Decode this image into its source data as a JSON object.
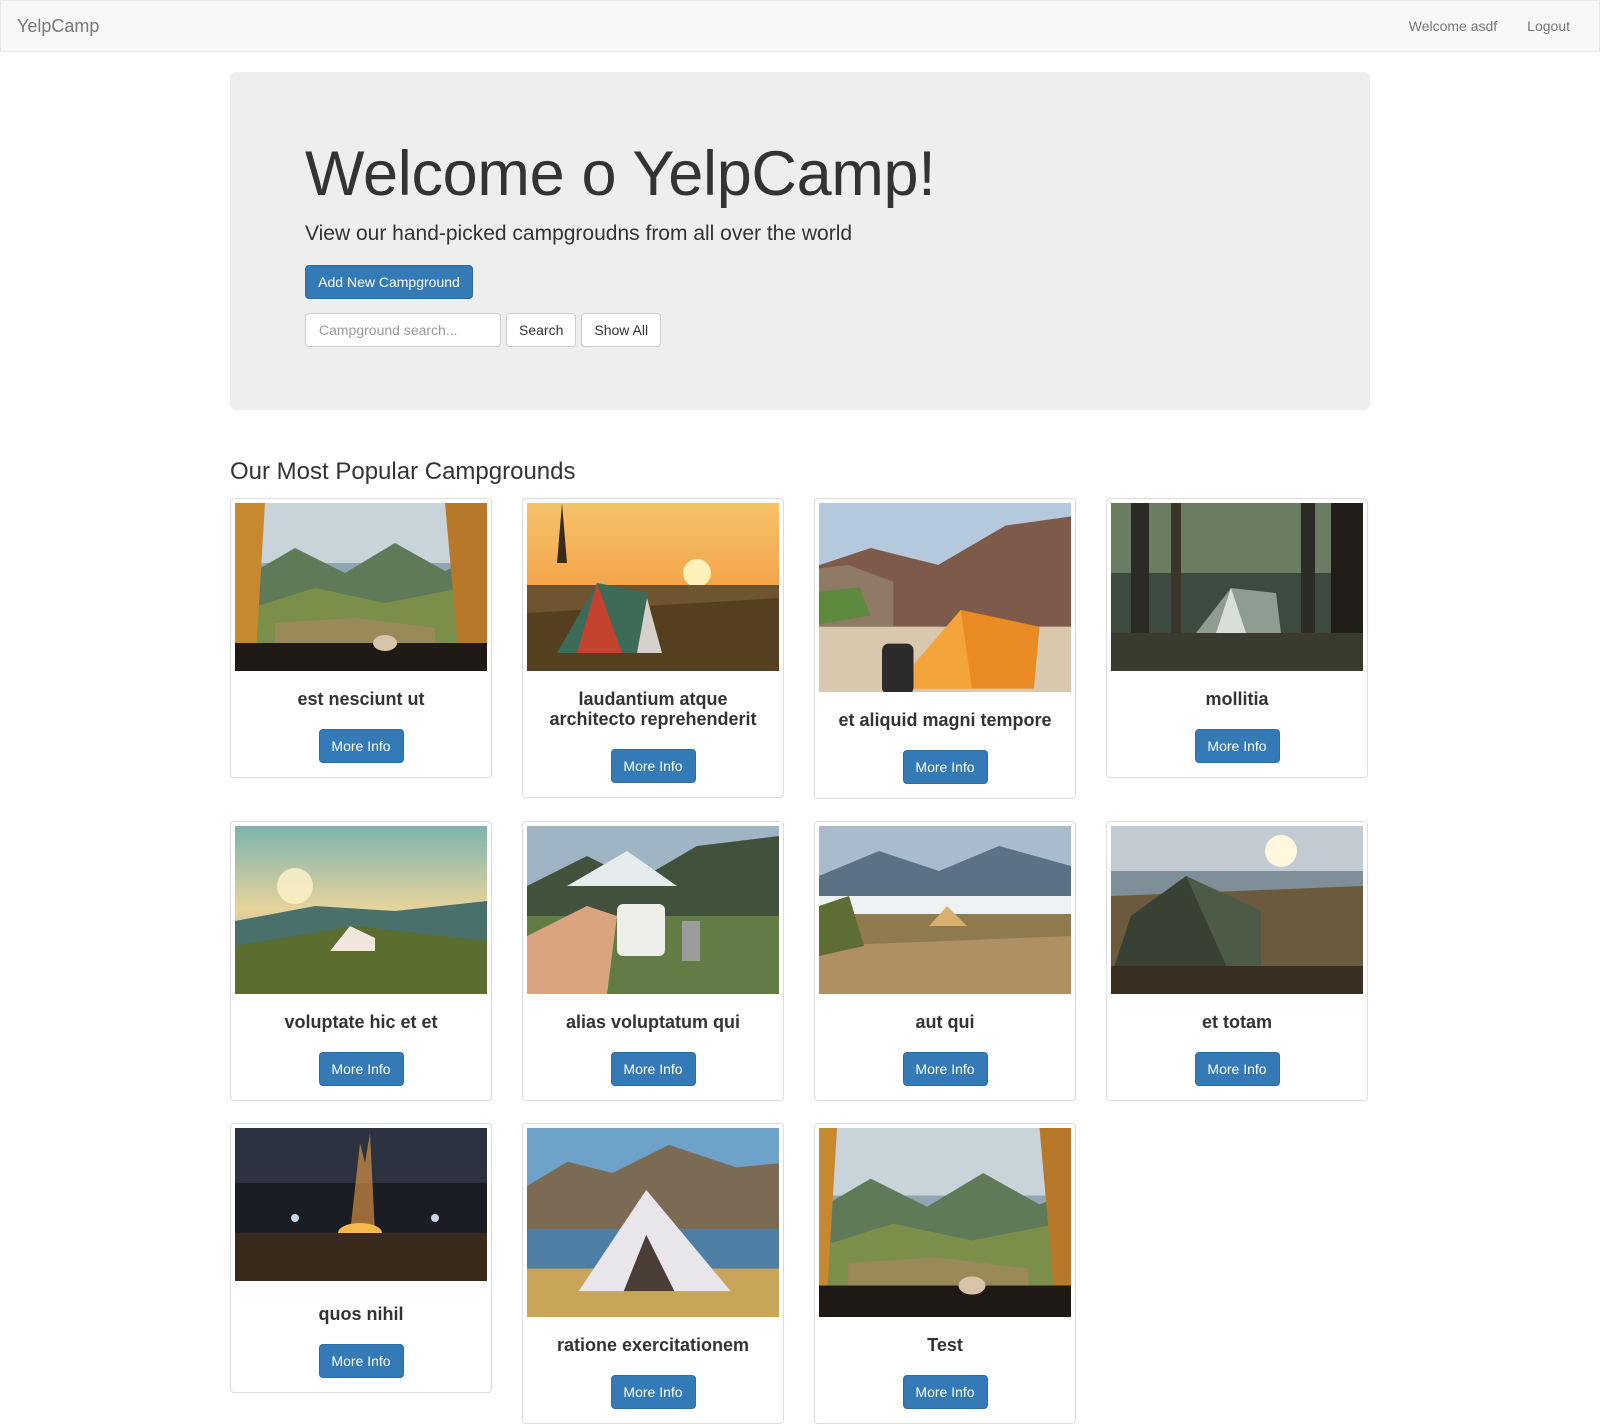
{
  "navbar": {
    "brand": "YelpCamp",
    "welcome": "Welcome asdf",
    "logout": "Logout"
  },
  "jumbotron": {
    "title": "Welcome o YelpCamp!",
    "subtitle": "View our hand-picked campgroudns from all over the world",
    "add_button": "Add New Campground",
    "search_placeholder": "Campground search...",
    "search_button": "Search",
    "show_all_button": "Show All"
  },
  "section": {
    "heading": "Our Most Popular Campgrounds"
  },
  "more_info_label": "More Info",
  "campgrounds": [
    {
      "name": "est nesciunt ut",
      "scene": "tent-view"
    },
    {
      "name": "laudantium atque architecto reprehenderit",
      "scene": "sunset-tent"
    },
    {
      "name": "et aliquid magni tempore",
      "scene": "orange-tent-canyon"
    },
    {
      "name": "mollitia",
      "scene": "forest-tent"
    },
    {
      "name": "voluptate hic et et",
      "scene": "mountain-sunrise"
    },
    {
      "name": "alias voluptatum qui",
      "scene": "mug-lake"
    },
    {
      "name": "aut qui",
      "scene": "cloud-valley"
    },
    {
      "name": "et totam",
      "scene": "lake-tent"
    },
    {
      "name": "quos nihil",
      "scene": "campfire"
    },
    {
      "name": "ratione exercitationem",
      "scene": "tent-lake-mountain"
    },
    {
      "name": "Test",
      "scene": "tent-view"
    }
  ]
}
